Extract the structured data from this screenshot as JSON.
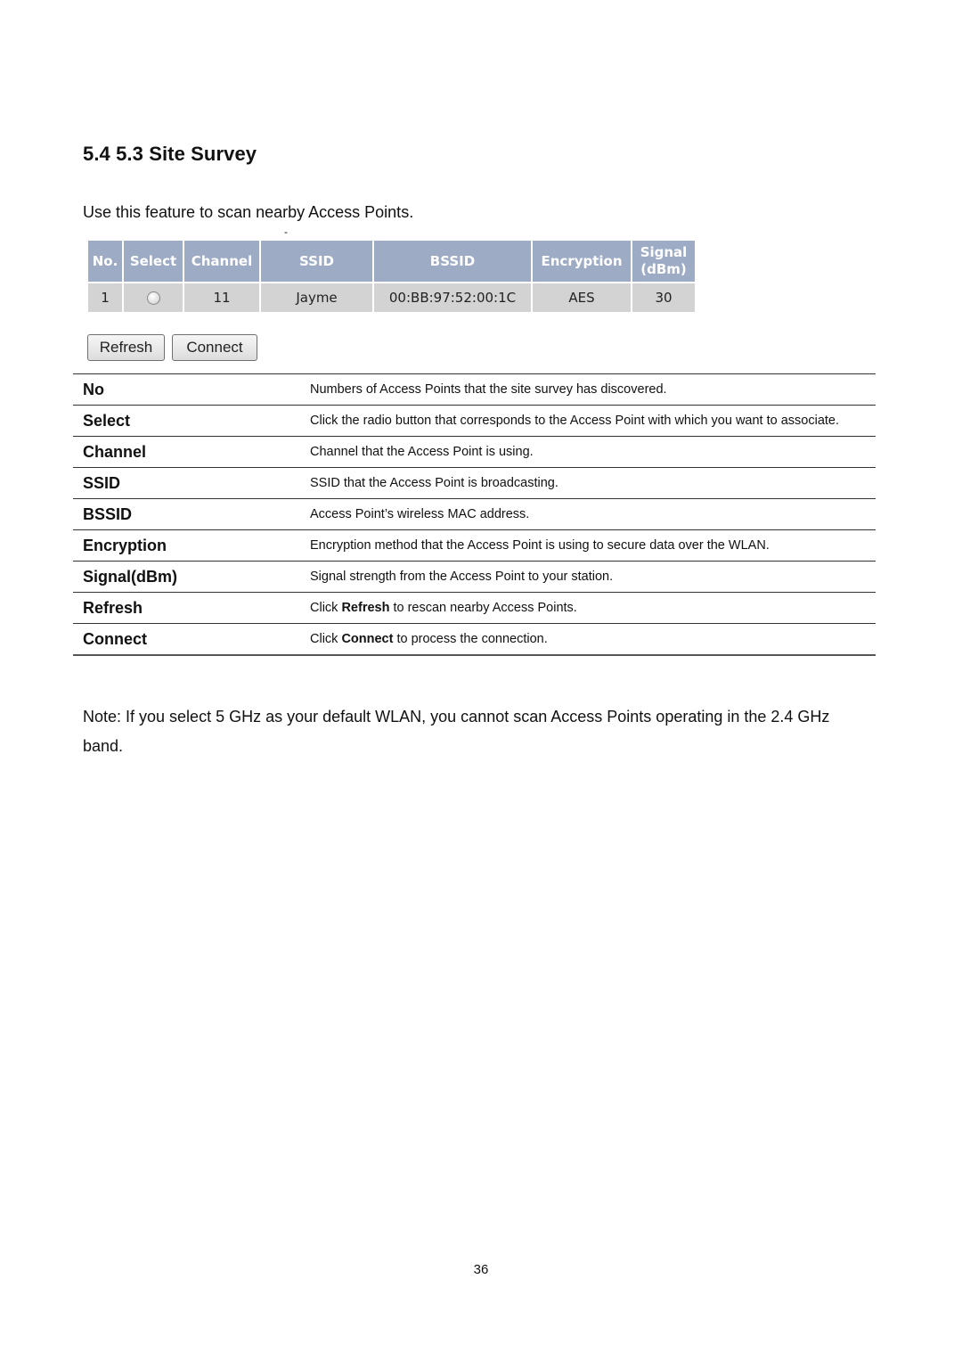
{
  "section_title": "5.4 5.3 Site Survey",
  "intro": "Use this feature to scan nearby Access Points.",
  "stray_mark": "-",
  "survey_table": {
    "headers": {
      "no": "No.",
      "select": "Select",
      "channel": "Channel",
      "ssid": "SSID",
      "bssid": "BSSID",
      "encryption": "Encryption",
      "signal_line1": "Signal",
      "signal_line2": "(dBm)"
    },
    "rows": [
      {
        "no": "1",
        "selected": false,
        "channel": "11",
        "ssid": "Jayme",
        "bssid": "00:BB:97:52:00:1C",
        "encryption": "AES",
        "signal": "30"
      }
    ],
    "colors": {
      "header_bg": "#9eabc4",
      "row_bg": "#d3d3d3"
    }
  },
  "buttons": {
    "refresh": "Refresh",
    "connect": "Connect"
  },
  "definitions": [
    {
      "term": "No",
      "desc": "Numbers of Access Points that the site survey has discovered."
    },
    {
      "term": "Select",
      "desc": "Click the radio button that corresponds to the Access Point with which you want to associate."
    },
    {
      "term": "Channel",
      "desc": "Channel that the Access Point is using."
    },
    {
      "term": "SSID",
      "desc": "SSID that the Access Point is broadcasting."
    },
    {
      "term": "BSSID",
      "desc": "Access Point’s wireless MAC address."
    },
    {
      "term": "Encryption",
      "desc": "Encryption method that the Access Point is using to secure data over the WLAN."
    },
    {
      "term": "Signal(dBm)",
      "desc": "Signal strength from the Access Point to your station."
    },
    {
      "term": "Refresh",
      "desc_pre": "Click ",
      "desc_bold": "Refresh",
      "desc_post": " to rescan nearby Access Points."
    },
    {
      "term": "Connect",
      "desc_pre": "Click ",
      "desc_bold": "Connect",
      "desc_post": " to process the connection."
    }
  ],
  "note": "Note: If you select 5 GHz as your default WLAN, you cannot scan Access Points operating in the 2.4 GHz band.",
  "page_number": "36"
}
